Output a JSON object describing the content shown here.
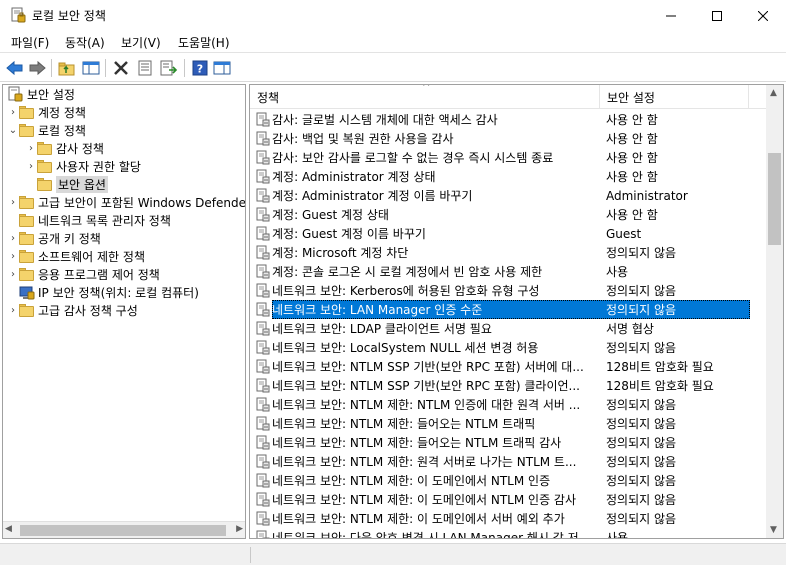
{
  "window": {
    "title": "로컬 보안 정책",
    "icons": {
      "app": "security-policy-icon",
      "minimize": "minimize-icon",
      "maximize": "maximize-icon",
      "close": "close-icon"
    }
  },
  "menu": [
    "파일(F)",
    "동작(A)",
    "보기(V)",
    "도움말(H)"
  ],
  "toolbar": {
    "buttons": [
      "back-arrow-icon",
      "forward-arrow-icon",
      "up-folder-icon",
      "show-hide-tree-icon",
      "delete-icon",
      "properties-icon",
      "export-list-icon",
      "help-icon",
      "show-hide-action-pane-icon"
    ]
  },
  "tree": {
    "root": "보안 설정",
    "items": [
      {
        "label": "계정 정책",
        "depth": 1,
        "expand": "closed"
      },
      {
        "label": "로컬 정책",
        "depth": 1,
        "expand": "open"
      },
      {
        "label": "감사 정책",
        "depth": 2,
        "expand": "closed"
      },
      {
        "label": "사용자 권한 할당",
        "depth": 2,
        "expand": "closed"
      },
      {
        "label": "보안 옵션",
        "depth": 2,
        "expand": "none",
        "selected": true
      },
      {
        "label": "고급 보안이 포함된 Windows Defender",
        "depth": 1,
        "expand": "closed"
      },
      {
        "label": "네트워크 목록 관리자 정책",
        "depth": 1,
        "expand": "none"
      },
      {
        "label": "공개 키 정책",
        "depth": 1,
        "expand": "closed"
      },
      {
        "label": "소프트웨어 제한 정책",
        "depth": 1,
        "expand": "closed"
      },
      {
        "label": "응용 프로그램 제어 정책",
        "depth": 1,
        "expand": "closed"
      },
      {
        "label": "IP 보안 정책(위치: 로컬 컴퓨터)",
        "depth": 1,
        "expand": "none",
        "special_icon": true
      },
      {
        "label": "고급 감사 정책 구성",
        "depth": 1,
        "expand": "closed"
      }
    ]
  },
  "list": {
    "headers": {
      "policy": "정책",
      "setting": "보안 설정"
    },
    "rows": [
      {
        "policy": "감사: 글로벌 시스템 개체에 대한 액세스 감사",
        "setting": "사용 안 함"
      },
      {
        "policy": "감사: 백업 및 복원 권한 사용을 감사",
        "setting": "사용 안 함"
      },
      {
        "policy": "감사: 보안 감사를 로그할 수 없는 경우 즉시 시스템 종료",
        "setting": "사용 안 함"
      },
      {
        "policy": "계정: Administrator 계정 상태",
        "setting": "사용 안 함"
      },
      {
        "policy": "계정: Administrator 계정 이름 바꾸기",
        "setting": "Administrator"
      },
      {
        "policy": "계정: Guest 계정 상태",
        "setting": "사용 안 함"
      },
      {
        "policy": "계정: Guest 계정 이름 바꾸기",
        "setting": "Guest"
      },
      {
        "policy": "계정: Microsoft 계정 차단",
        "setting": "정의되지 않음"
      },
      {
        "policy": "계정: 콘솔 로그온 시 로컬 계정에서 빈 암호 사용 제한",
        "setting": "사용"
      },
      {
        "policy": "네트워크 보안: Kerberos에 허용된 암호화 유형 구성",
        "setting": "정의되지 않음"
      },
      {
        "policy": "네트워크 보안: LAN Manager 인증 수준",
        "setting": "정의되지 않음",
        "selected": true
      },
      {
        "policy": "네트워크 보안: LDAP 클라이언트 서명 필요",
        "setting": "서명 협상"
      },
      {
        "policy": "네트워크 보안: LocalSystem NULL 세션 변경 허용",
        "setting": "정의되지 않음"
      },
      {
        "policy": "네트워크 보안: NTLM SSP 기반(보안 RPC 포함) 서버에 대...",
        "setting": "128비트 암호화 필요"
      },
      {
        "policy": "네트워크 보안: NTLM SSP 기반(보안 RPC 포함) 클라이언...",
        "setting": "128비트 암호화 필요"
      },
      {
        "policy": "네트워크 보안: NTLM 제한: NTLM 인증에 대한 원격 서버 ...",
        "setting": "정의되지 않음"
      },
      {
        "policy": "네트워크 보안: NTLM 제한: 들어오는 NTLM 트래픽",
        "setting": "정의되지 않음"
      },
      {
        "policy": "네트워크 보안: NTLM 제한: 들어오는 NTLM 트래픽 감사",
        "setting": "정의되지 않음"
      },
      {
        "policy": "네트워크 보안: NTLM 제한: 원격 서버로 나가는 NTLM 트...",
        "setting": "정의되지 않음"
      },
      {
        "policy": "네트워크 보안: NTLM 제한: 이 도메인에서 NTLM 인증",
        "setting": "정의되지 않음"
      },
      {
        "policy": "네트워크 보안: NTLM 제한: 이 도메인에서 NTLM 인증 감사",
        "setting": "정의되지 않음"
      },
      {
        "policy": "네트워크 보안: NTLM 제한: 이 도메인에서 서버 예외 추가",
        "setting": "정의되지 않음"
      },
      {
        "policy": "네트워크 보안: 다음 암호 변경 시 LAN Manager 해시 값 저...",
        "setting": "사용"
      }
    ]
  }
}
